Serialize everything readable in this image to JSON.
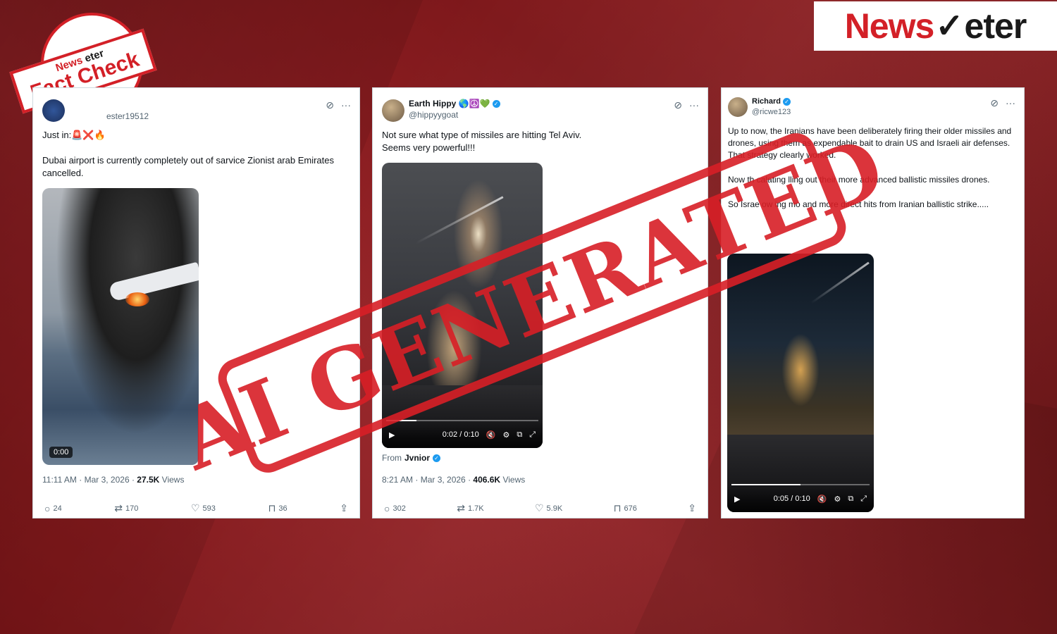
{
  "brand": {
    "news": "News",
    "meter": "eter"
  },
  "badge": {
    "top": "News",
    "top_brand": "eter",
    "main": "Fact Check"
  },
  "stamp": {
    "text": "AI GENERATED"
  },
  "tweets": [
    {
      "name": "",
      "handle": "ester19512",
      "lines": [
        "Just in:🚨❌🔥",
        "Dubai airport is currently completely out of sarvice Zionist arab Emirates cancelled."
      ],
      "video_time": "0:00",
      "time": "11:11 AM · Mar 3, 2026 · ",
      "views": "27.5K",
      "views_label": " Views",
      "replies": "24",
      "reposts": "170",
      "likes": "593",
      "bookmarks": "36"
    },
    {
      "name": "Earth Hippy 🌎☮️💚",
      "handle": "@hippyygoat",
      "lines": [
        "Not sure what type of missiles are hitting Tel Aviv.",
        "Seems very powerful!!!"
      ],
      "video_time": "0:02 / 0:10",
      "from_label": "From",
      "from_name": "Jvnior",
      "time": "8:21 AM · Mar 3, 2026 · ",
      "views": "406.6K",
      "views_label": " Views",
      "replies": "302",
      "reposts": "1.7K",
      "likes": "5.9K",
      "bookmarks": "676"
    },
    {
      "name": "Richard",
      "handle": "@ricwe123",
      "lines": [
        "Up to now, the Iranians have been deliberately firing their older missiles and drones, using them as expendable bait to drain US and Israeli air defenses.",
        "That strategy clearly worked.",
        "Now th      calating    lling out their more advanced ballistic missiles       drones.",
        "So Israe    ow     ing mo    and more direct hits from Iranian ballistic strike....."
      ],
      "video_time": "0:05 / 0:10"
    }
  ],
  "icons": {
    "grok": "⊘",
    "more": "···",
    "reply": "○",
    "repost": "⇄",
    "like": "♡",
    "bookmark": "⊓",
    "share": "⇪",
    "play": "▶",
    "mute": "🔇",
    "settings": "⚙",
    "pip": "⧉",
    "fullscreen": "⤢"
  }
}
